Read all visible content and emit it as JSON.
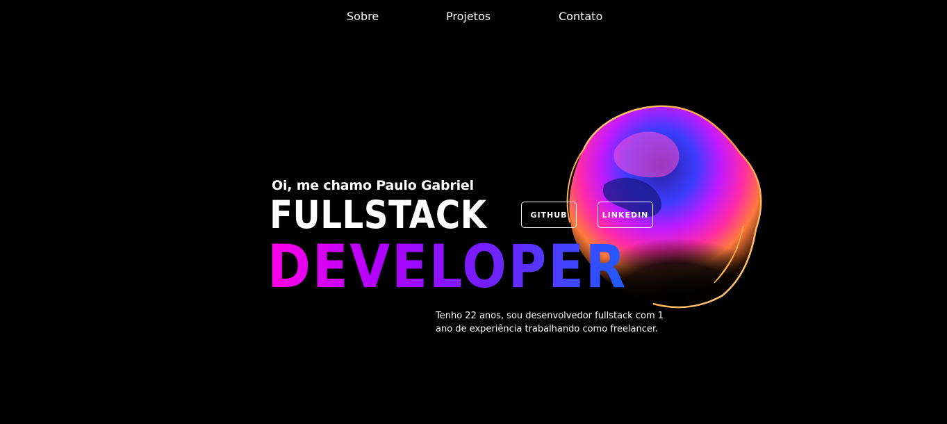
{
  "nav": {
    "items": [
      {
        "label": "Sobre"
      },
      {
        "label": "Projetos"
      },
      {
        "label": "Contato"
      }
    ]
  },
  "hero": {
    "greeting": "Oi, me chamo Paulo Gabriel",
    "title_line1": "FULLSTACK",
    "title_line2": "DEVELOPER",
    "bio": "Tenho 22 anos, sou desenvolvedor fullstack com 1 ano de experiência trabalhando como freelancer."
  },
  "social": {
    "github_label": "GITHUB",
    "linkedin_label": "LINKEDIN"
  },
  "colors": {
    "background": "#000000",
    "text": "#ffffff",
    "gradient_start": "#ff00e6",
    "gradient_mid": "#7a1bff",
    "gradient_end": "#1f5cff",
    "blob_rim": "#ffb347"
  },
  "decor": {
    "blob_icon": "iridescent-blob-graphic"
  }
}
